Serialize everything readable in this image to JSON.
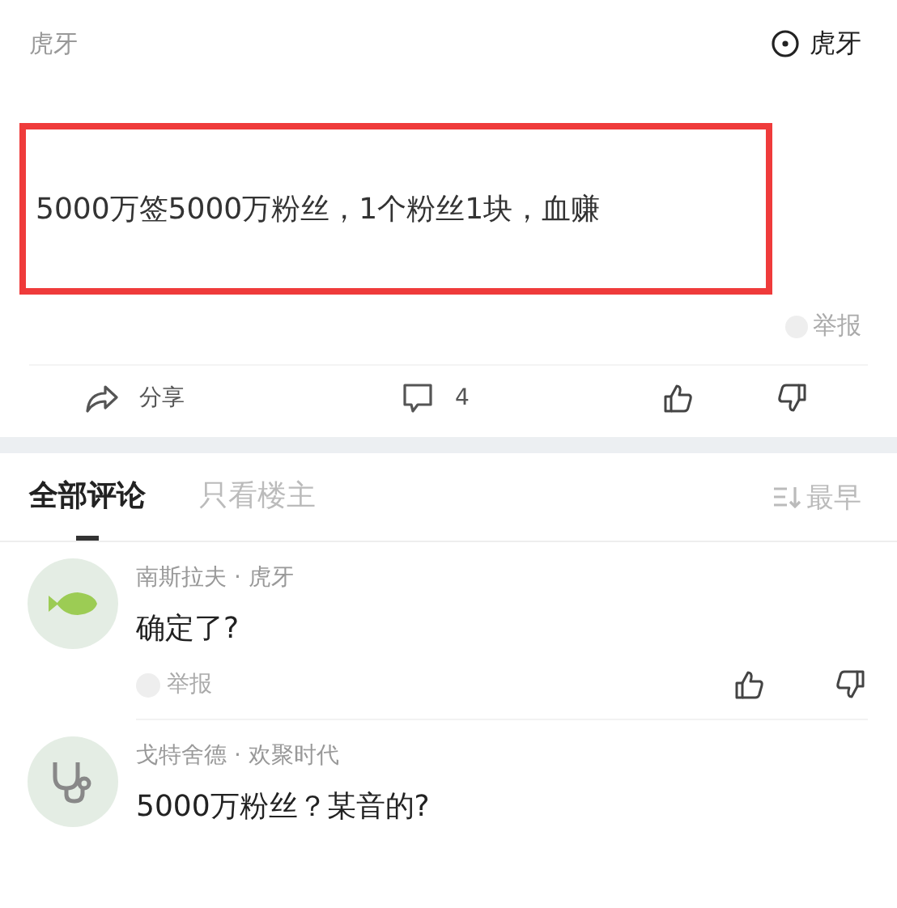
{
  "header": {
    "source": "虎牙",
    "follow_label": "虎牙"
  },
  "post": {
    "text": "5000万签5000万粉丝，1个粉丝1块，血赚",
    "highlighted": true,
    "report": "举报"
  },
  "actions": {
    "share": "分享",
    "comments": "4"
  },
  "tabs": [
    {
      "label": "全部评论",
      "selected": true
    },
    {
      "label": "只看楼主",
      "selected": false
    }
  ],
  "sort": "最早",
  "comments": [
    {
      "author": "南斯拉夫 · 虎牙",
      "text": "确定了?",
      "report": "举报"
    },
    {
      "author": "戈特舍德 · 欢聚时代",
      "text": "5000万粉丝？某音的?"
    }
  ]
}
